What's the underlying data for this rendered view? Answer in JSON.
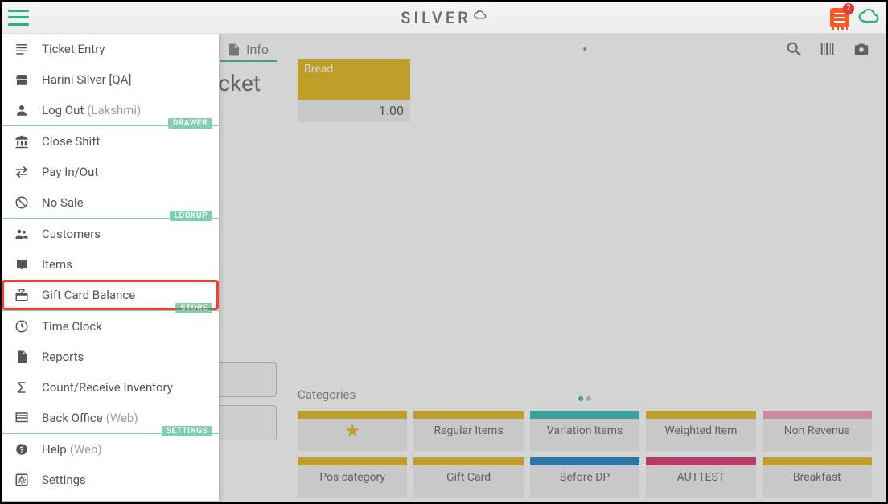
{
  "topbar": {
    "brand": "SILVER",
    "notification_count": "2"
  },
  "sidebar": {
    "sections": {
      "drawer_label": "DRAWER",
      "lookup_label": "LOOKUP",
      "store_label": "STORE",
      "settings_label": "SETTINGS"
    },
    "items": {
      "ticket_entry": "Ticket Entry",
      "store_name": "Harini Silver [QA]",
      "logout": "Log Out",
      "logout_user": "(Lakshmi)",
      "close_shift": "Close Shift",
      "pay_in_out": "Pay In/Out",
      "no_sale": "No Sale",
      "customers": "Customers",
      "items": "Items",
      "gift_card_balance": "Gift Card Balance",
      "time_clock": "Time Clock",
      "reports": "Reports",
      "count_receive": "Count/Receive Inventory",
      "back_office": "Back Office",
      "back_office_sub": "(Web)",
      "help": "Help",
      "help_sub": "(Web)",
      "settings": "Settings"
    }
  },
  "main": {
    "info_label": "Info",
    "ticket_word": "ticket",
    "tile": {
      "name": "Bread",
      "price": "1.00"
    },
    "categories_label": "Categories",
    "categories": [
      {
        "label": "",
        "stripe": "c-yellow",
        "star": true
      },
      {
        "label": "Regular Items",
        "stripe": "c-yellow"
      },
      {
        "label": "Variation Items",
        "stripe": "c-teal"
      },
      {
        "label": "Weighted Item",
        "stripe": "c-yellow"
      },
      {
        "label": "Non Revenue",
        "stripe": "c-pink"
      },
      {
        "label": "Pos category",
        "stripe": "c-yellow"
      },
      {
        "label": "Gift Card",
        "stripe": "c-yellow"
      },
      {
        "label": "Before DP",
        "stripe": "c-blue"
      },
      {
        "label": "AUTTEST",
        "stripe": "c-magenta"
      },
      {
        "label": "Breakfast",
        "stripe": "c-yellow"
      }
    ]
  }
}
